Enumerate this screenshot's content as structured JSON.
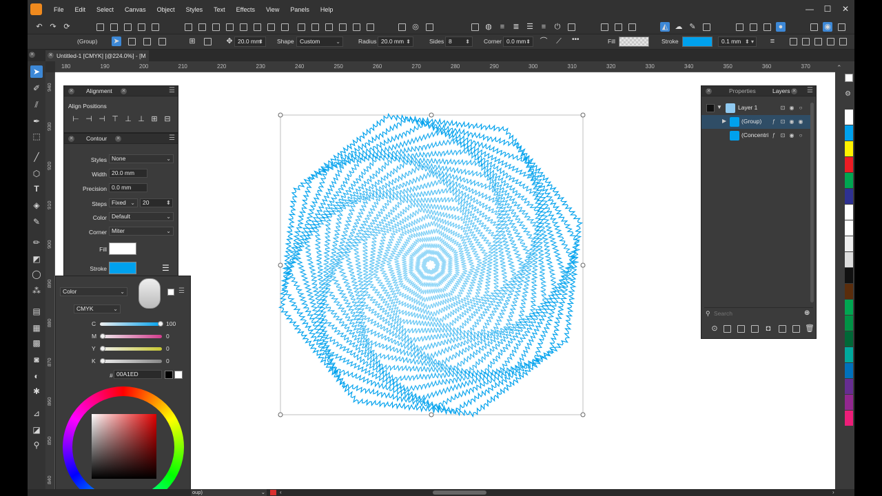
{
  "menu": [
    "File",
    "Edit",
    "Select",
    "Canvas",
    "Object",
    "Styles",
    "Text",
    "Effects",
    "View",
    "Panels",
    "Help"
  ],
  "window_controls": {
    "minimize": "—",
    "maximize": "☐",
    "close": "✕"
  },
  "property_bar": {
    "selection_label": "(Group)",
    "size_value": "20.0 mm",
    "shape_label": "Shape",
    "shape_value": "Custom",
    "radius_label": "Radius",
    "radius_value": "20.0 mm",
    "sides_label": "Sides",
    "sides_value": "8",
    "corner_label": "Corner",
    "corner_value": "0.0 mm",
    "more": "•••",
    "fill_label": "Fill",
    "stroke_label": "Stroke",
    "stroke_width": "0.1 mm",
    "stroke_color": "#00a1ed"
  },
  "document_tab": {
    "title": "Untitled-1 [CMYK] [@224.0%] - [M"
  },
  "rulers": {
    "horizontal": [
      "180",
      "190",
      "200",
      "210",
      "220",
      "230",
      "240",
      "250",
      "260",
      "270",
      "280",
      "290",
      "300",
      "310",
      "320",
      "330",
      "340",
      "350",
      "360",
      "370"
    ],
    "vertical": [
      "940",
      "930",
      "920",
      "910",
      "900",
      "890",
      "880",
      "870",
      "860",
      "850",
      "840"
    ]
  },
  "alignment_panel": {
    "title": "Alignment",
    "section": "Align Positions"
  },
  "contour_panel": {
    "title": "Contour",
    "styles_label": "Styles",
    "styles_value": "None",
    "width_label": "Width",
    "width_value": "20.0 mm",
    "precision_label": "Precision",
    "precision_value": "0.0 mm",
    "steps_label": "Steps",
    "steps_mode": "Fixed",
    "steps_value": "20",
    "color_label": "Color",
    "color_value": "Default",
    "corner_label": "Corner",
    "corner_value": "Miter",
    "fill_label": "Fill",
    "stroke_label": "Stroke"
  },
  "color_picker": {
    "mode": "Color",
    "model": "CMYK",
    "channels": [
      {
        "name": "C",
        "value": "100",
        "fraction": 1.0,
        "color": "#00a1ed"
      },
      {
        "name": "M",
        "value": "0",
        "fraction": 0.0,
        "color": "#d23c8c"
      },
      {
        "name": "Y",
        "value": "0",
        "fraction": 0.0,
        "color": "#c8c832"
      },
      {
        "name": "K",
        "value": "0",
        "fraction": 0.0,
        "color": "#888888"
      }
    ],
    "hex_label": "#",
    "hex_value": "00A1ED"
  },
  "layers_panel": {
    "tabs": [
      "Properties",
      "Layers"
    ],
    "rows": [
      {
        "name": "Layer 1"
      },
      {
        "name": "(Group)"
      },
      {
        "name": "(Concentri"
      }
    ],
    "search_placeholder": "Search"
  },
  "status": {
    "selection": "oup)"
  },
  "accent_color": "#3d88d6",
  "art_color": "#00a1ed"
}
